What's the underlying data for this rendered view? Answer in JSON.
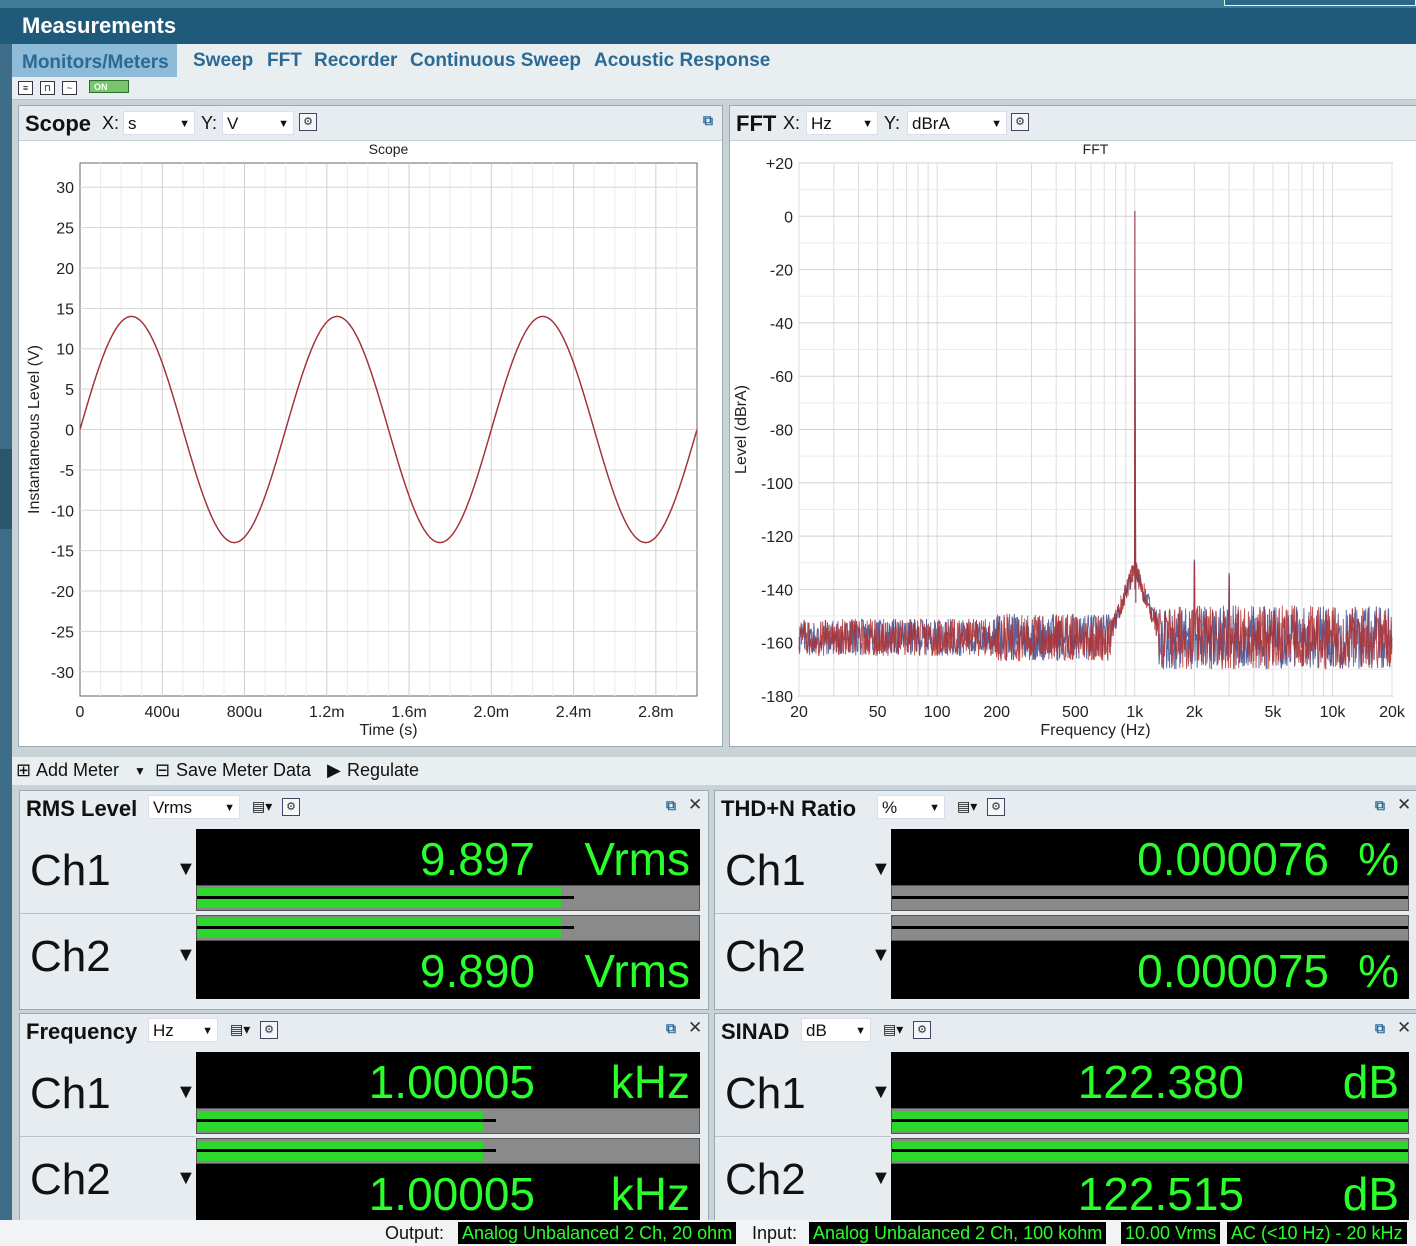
{
  "window": {
    "title": "Measurements"
  },
  "tabs": [
    "Monitors/Meters",
    "Sweep",
    "FFT",
    "Recorder",
    "Continuous Sweep",
    "Acoustic Response"
  ],
  "toolstrip": {
    "on_label": "ON"
  },
  "scope": {
    "title": "Scope",
    "x_label": "X:",
    "x_unit": "s",
    "y_label": "Y:",
    "y_unit": "V",
    "chart_data": {
      "type": "line",
      "title": "Scope",
      "xlabel": "Time (s)",
      "ylabel": "Instantaneous Level (V)",
      "xlim": [
        0,
        0.003
      ],
      "ylim": [
        -33,
        33
      ],
      "x_ticks": [
        "0",
        "400u",
        "800u",
        "1.2m",
        "1.6m",
        "2.0m",
        "2.4m",
        "2.8m"
      ],
      "y_ticks": [
        "30",
        "25",
        "20",
        "15",
        "10",
        "5",
        "0",
        "-5",
        "-10",
        "-15",
        "-20",
        "-25",
        "-30"
      ],
      "grid": true,
      "series": [
        {
          "color": "#2f3f7f",
          "amplitude": 14.0,
          "frequency_hz": 1000,
          "phase_deg": 0
        },
        {
          "color": "#b03030",
          "amplitude": 14.0,
          "frequency_hz": 1000,
          "phase_deg": 0
        }
      ]
    }
  },
  "fft": {
    "title": "FFT",
    "x_label": "X:",
    "x_unit": "Hz",
    "y_label": "Y:",
    "y_unit": "dBrA",
    "chart_data": {
      "type": "line",
      "title": "FFT",
      "xlabel": "Frequency (Hz)",
      "ylabel": "Level (dBrA)",
      "xscale": "log",
      "xlim": [
        20,
        20000
      ],
      "ylim": [
        -180,
        20
      ],
      "x_ticks": [
        "20",
        "50",
        "100",
        "200",
        "500",
        "1k",
        "2k",
        "5k",
        "10k",
        "20k"
      ],
      "y_ticks": [
        "+20",
        "0",
        "-20",
        "-40",
        "-60",
        "-80",
        "-100",
        "-120",
        "-140",
        "-160",
        "-180"
      ],
      "grid": true,
      "series": [
        {
          "color": "#3a4a8f",
          "peaks": [
            [
              1000,
              2
            ],
            [
              2000,
              -129
            ],
            [
              3000,
              -135
            ]
          ],
          "noise_floor_db": -158
        },
        {
          "color": "#b03030",
          "peaks": [
            [
              1000,
              2
            ],
            [
              2000,
              -130
            ],
            [
              3000,
              -134
            ]
          ],
          "noise_floor_db": -158
        }
      ]
    }
  },
  "meterbar": {
    "add_meter": "Add Meter",
    "save_meter_data": "Save Meter Data",
    "regulate": "Regulate"
  },
  "meters": [
    {
      "title": "RMS Level",
      "unit_select": "Vrms",
      "channels": [
        {
          "label": "Ch1",
          "value": "9.897",
          "unit": "Vrms",
          "bar_level": 0.725
        },
        {
          "label": "Ch2",
          "value": "9.890",
          "unit": "Vrms",
          "bar_level": 0.725
        }
      ]
    },
    {
      "title": "THD+N Ratio",
      "unit_select": "%",
      "channels": [
        {
          "label": "Ch1",
          "value": "0.000076",
          "unit": "%",
          "bar_level": 0.0
        },
        {
          "label": "Ch2",
          "value": "0.000075",
          "unit": "%",
          "bar_level": 0.0
        }
      ]
    },
    {
      "title": "Frequency",
      "unit_select": "Hz",
      "channels": [
        {
          "label": "Ch1",
          "value": "1.00005",
          "unit": "kHz",
          "bar_level": 0.57
        },
        {
          "label": "Ch2",
          "value": "1.00005",
          "unit": "kHz",
          "bar_level": 0.57
        }
      ]
    },
    {
      "title": "SINAD",
      "unit_select": "dB",
      "channels": [
        {
          "label": "Ch1",
          "value": "122.380",
          "unit": "dB",
          "bar_level": 1.0
        },
        {
          "label": "Ch2",
          "value": "122.515",
          "unit": "dB",
          "bar_level": 1.0
        }
      ]
    }
  ],
  "status": {
    "output_label": "Output:",
    "output_value": "Analog Unbalanced 2 Ch, 20 ohm",
    "input_label": "Input:",
    "input_value": "Analog Unbalanced 2 Ch, 100 kohm",
    "range_value": "10.00 Vrms",
    "filter_value": "AC (<10 Hz) - 20 kHz"
  },
  "colors": {
    "accent": "#1f5a7a",
    "readout_text": "#2bff2b",
    "bar_fill": "#2bd82b"
  }
}
